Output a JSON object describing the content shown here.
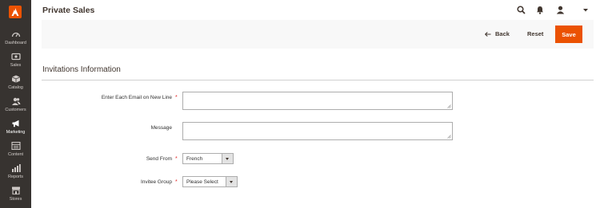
{
  "sidebar": {
    "items": [
      {
        "label": "Dashboard",
        "icon": "dashboard-icon"
      },
      {
        "label": "Sales",
        "icon": "dollar-icon"
      },
      {
        "label": "Catalog",
        "icon": "box-icon"
      },
      {
        "label": "Customers",
        "icon": "customers-icon"
      },
      {
        "label": "Marketing",
        "icon": "megaphone-icon"
      },
      {
        "label": "Content",
        "icon": "content-icon"
      },
      {
        "label": "Reports",
        "icon": "bar-chart-icon"
      },
      {
        "label": "Stores",
        "icon": "store-icon"
      }
    ],
    "active": "Marketing"
  },
  "header": {
    "title": "Private Sales"
  },
  "actions": {
    "back_label": "Back",
    "reset_label": "Reset",
    "save_label": "Save"
  },
  "section": {
    "title": "Invitations Information"
  },
  "form": {
    "email_label": "Enter Each Email on New Line",
    "message_label": "Message",
    "send_from_label": "Send From",
    "send_from_value": "French",
    "invitee_group_label": "Invitee Group",
    "invitee_group_value": "Please Select",
    "required_mark": "*"
  },
  "colors": {
    "accent": "#eb5202",
    "sidebar": "#373330",
    "required": "#e22626"
  }
}
